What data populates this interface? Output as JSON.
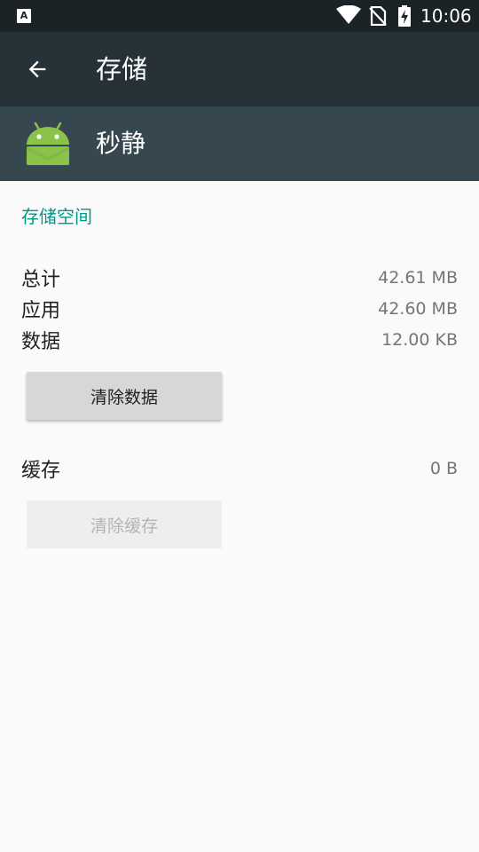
{
  "status_bar": {
    "notification_icon": "A",
    "time": "10:06",
    "icons": [
      "wifi-icon",
      "no-sim-icon",
      "battery-charging-icon"
    ]
  },
  "toolbar": {
    "back_icon": "arrow-back-icon",
    "title": "存储"
  },
  "app": {
    "icon": "android-robot-icon",
    "name": "秒静"
  },
  "storage": {
    "section_title": "存储空间",
    "rows": [
      {
        "label": "总计",
        "value": "42.61 MB"
      },
      {
        "label": "应用",
        "value": "42.60 MB"
      },
      {
        "label": "数据",
        "value": "12.00 KB"
      }
    ],
    "clear_data_label": "清除数据"
  },
  "cache": {
    "label": "缓存",
    "value": "0 B",
    "clear_cache_label": "清除缓存",
    "clear_cache_enabled": false
  },
  "colors": {
    "status_bar": "#1b2327",
    "toolbar": "#263238",
    "app_header": "#37474f",
    "accent": "#009688",
    "android_green": "#8bc34a"
  }
}
